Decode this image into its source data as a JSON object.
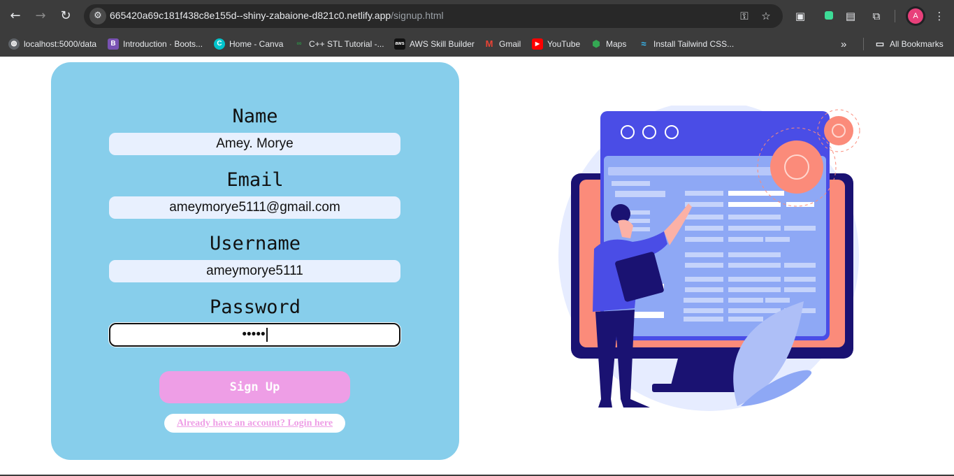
{
  "browser": {
    "url_host": "665420a69c181f438c8e155d--shiny-zabaione-d821c0.netlify.app",
    "url_path": "/signup.html",
    "profile_initial": "A",
    "bookmarks": [
      {
        "label": "localhost:5000/data",
        "icon": "globe-icon",
        "color": "#5f6368"
      },
      {
        "label": "Introduction · Boots...",
        "icon": "bootstrap-icon",
        "color": "#7952b3"
      },
      {
        "label": "Home - Canva",
        "icon": "canva-icon",
        "color": "#00c4cc"
      },
      {
        "label": "C++ STL Tutorial -...",
        "icon": "gfg-icon",
        "color": "#2f8d46"
      },
      {
        "label": "AWS Skill Builder",
        "icon": "aws-icon",
        "color": "#232f3e"
      },
      {
        "label": "Gmail",
        "icon": "gmail-icon",
        "color": "#ea4335"
      },
      {
        "label": "YouTube",
        "icon": "youtube-icon",
        "color": "#ff0000"
      },
      {
        "label": "Maps",
        "icon": "maps-icon",
        "color": "#34a853"
      },
      {
        "label": "Install Tailwind CSS...",
        "icon": "tailwind-icon",
        "color": "#38bdf8"
      }
    ],
    "all_bookmarks_label": "All Bookmarks"
  },
  "form": {
    "name_label": "Name",
    "name_value": "Amey. Morye",
    "email_label": "Email",
    "email_value": "ameymorye5111@gmail.com",
    "username_label": "Username",
    "username_value": "ameymorye5111",
    "password_label": "Password",
    "password_value": "•••••",
    "signup_label": "Sign Up",
    "login_link": "Already have an account? Login here"
  },
  "colors": {
    "card": "#87ceeb",
    "accent_pink": "#ee9ee6",
    "input_bg": "#e8f0fe"
  }
}
